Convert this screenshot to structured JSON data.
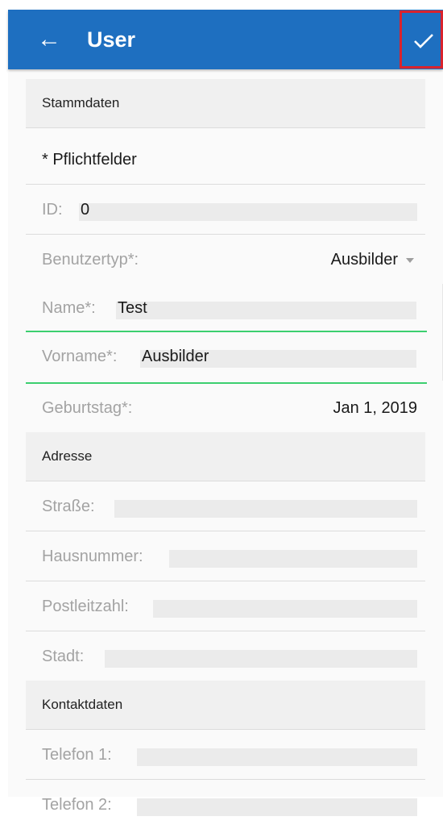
{
  "toolbar": {
    "title": "User",
    "back_icon": "arrow-left-icon",
    "save_icon": "check-icon"
  },
  "sections": {
    "stammdaten": "Stammdaten",
    "adresse": "Adresse",
    "kontaktdaten": "Kontaktdaten"
  },
  "stammdaten": {
    "required_note": "* Pflichtfelder",
    "id_label": "ID:",
    "id_value": "0",
    "benutzertyp_label": "Benutzertyp*:",
    "benutzertyp_value": "Ausbilder",
    "name_label": "Name*:",
    "name_value": "Test",
    "vorname_label": "Vorname*:",
    "vorname_value": "Ausbilder",
    "geburtstag_label": "Geburtstag*:",
    "geburtstag_value": "Jan 1, 2019"
  },
  "adresse": {
    "strasse_label": "Straße:",
    "strasse_value": "",
    "hausnummer_label": "Hausnummer:",
    "hausnummer_value": "",
    "plz_label": "Postleitzahl:",
    "plz_value": "",
    "stadt_label": "Stadt:",
    "stadt_value": ""
  },
  "kontakt": {
    "telefon1_label": "Telefon 1:",
    "telefon1_value": "",
    "telefon2_label": "Telefon 2:",
    "telefon2_value": ""
  },
  "colors": {
    "toolbar": "#1e6fc0",
    "focus_line": "#3ccf6f",
    "highlight_border": "#d9232d"
  }
}
